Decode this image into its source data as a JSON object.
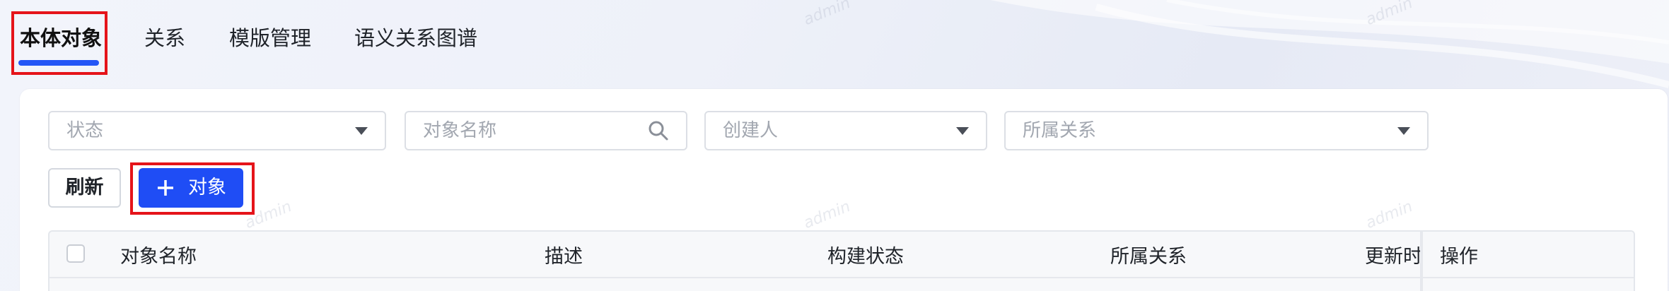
{
  "tabs": [
    {
      "label": "本体对象",
      "active": true
    },
    {
      "label": "关系",
      "active": false
    },
    {
      "label": "模版管理",
      "active": false
    },
    {
      "label": "语义关系图谱",
      "active": false
    }
  ],
  "filters": {
    "status": {
      "placeholder": "状态",
      "icon": "chevron-down-icon"
    },
    "object_name": {
      "placeholder": "对象名称",
      "icon": "search-icon"
    },
    "creator": {
      "placeholder": "创建人",
      "icon": "chevron-down-icon"
    },
    "relation": {
      "placeholder": "所属关系",
      "icon": "chevron-down-icon"
    }
  },
  "toolbar": {
    "refresh_label": "刷新",
    "add_label": "对象",
    "add_icon": "plus-icon"
  },
  "table": {
    "columns": [
      "对象名称",
      "描述",
      "构建状态",
      "所属关系",
      "更新时",
      "操作"
    ]
  },
  "watermark": "admin",
  "colors": {
    "accent": "#1f4df5",
    "highlight": "#e5141a",
    "tab_underline": "#2456f6"
  }
}
